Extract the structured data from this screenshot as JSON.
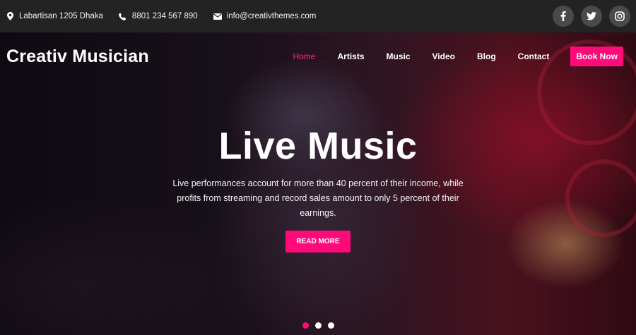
{
  "topbar": {
    "address": "Labartisan 1205 Dhaka",
    "phone": "8801 234 567 890",
    "email": "info@creativthemes.com",
    "social": [
      {
        "icon": "facebook-icon",
        "glyph": "f"
      },
      {
        "icon": "twitter-icon",
        "glyph": "t"
      },
      {
        "icon": "instagram-icon",
        "glyph": "i"
      }
    ]
  },
  "header": {
    "brand": "Creativ Musician",
    "nav": [
      "Home",
      "Artists",
      "Music",
      "Video",
      "Blog",
      "Contact"
    ],
    "active_nav": "Home",
    "cta": "Book Now"
  },
  "hero": {
    "title": "Live Music",
    "description": "Live performances account for more than 40 percent of their income, while profits from streaming and record sales amount to only 5 percent of their earnings.",
    "button": "READ MORE",
    "slides_total": 3,
    "active_slide": 1
  },
  "colors": {
    "accent": "#ff0a78",
    "topbar_bg": "#232323",
    "social_bg": "#4a4a4a"
  }
}
